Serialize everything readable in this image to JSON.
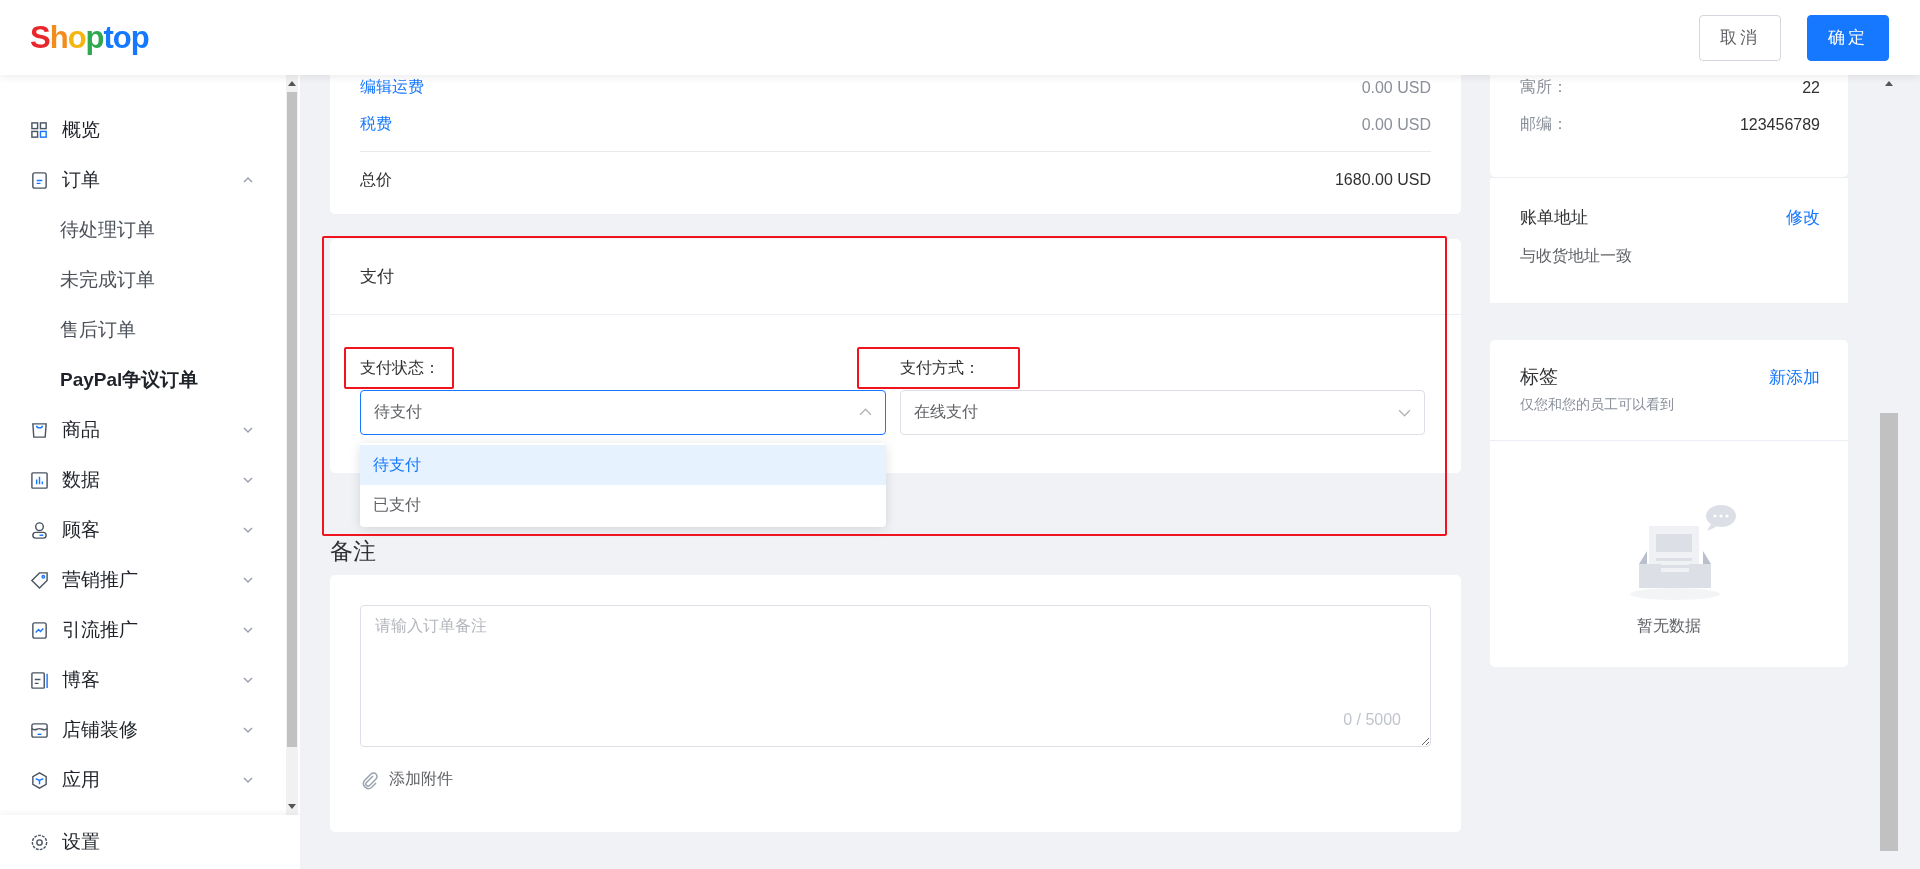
{
  "logo": "Shoptop",
  "header_buttons": [
    {
      "label": "取消",
      "kind": "secondary"
    },
    {
      "label": "确定",
      "kind": "primary"
    }
  ],
  "sidebar": {
    "items": [
      {
        "label": "概览"
      },
      {
        "label": "订单",
        "expanded": true,
        "children": [
          {
            "label": "待处理订单",
            "selected": false
          },
          {
            "label": "未完成订单",
            "selected": false
          },
          {
            "label": "售后订单",
            "selected": false
          },
          {
            "label": "PayPal争议订单",
            "selected": true
          }
        ]
      },
      {
        "label": "商品",
        "expanded": false
      },
      {
        "label": "数据",
        "expanded": false
      },
      {
        "label": "顾客",
        "expanded": false
      },
      {
        "label": "营销推广",
        "expanded": false
      },
      {
        "label": "引流推广",
        "expanded": false
      },
      {
        "label": "博客",
        "expanded": false
      },
      {
        "label": "店铺装修",
        "expanded": false
      },
      {
        "label": "应用",
        "expanded": false
      }
    ],
    "footer": {
      "label": "设置"
    }
  },
  "summary": {
    "rows": [
      {
        "label": "编辑运费",
        "value": "0.00 USD",
        "kind": "link"
      },
      {
        "label": "税费",
        "value": "0.00 USD",
        "kind": "link"
      },
      {
        "label": "总价",
        "value": "1680.00 USD",
        "kind": "total"
      }
    ]
  },
  "payment": {
    "title": "支付",
    "highlighted": true,
    "fields": [
      {
        "label": "支付状态：",
        "highlighted": true,
        "value": "待支付",
        "open": true,
        "options": [
          {
            "label": "待支付",
            "selected": true
          },
          {
            "label": "已支付",
            "selected": false
          }
        ]
      },
      {
        "label": "支付方式：",
        "highlighted": true,
        "value": "在线支付",
        "open": false
      }
    ]
  },
  "remark": {
    "title": "备注",
    "placeholder": "请输入订单备注",
    "counter": "0 / 5000",
    "attach": "添加附件"
  },
  "address": {
    "rows": [
      {
        "label": "寓所：",
        "value": "22"
      },
      {
        "label": "邮编：",
        "value": "123456789"
      }
    ]
  },
  "billing": {
    "title": "账单地址",
    "action": "修改",
    "text": "与收货地址一致"
  },
  "tags": {
    "title": "标签",
    "action": "新添加",
    "subtitle": "仅您和您的员工可以看到",
    "empty": "暂无数据"
  }
}
